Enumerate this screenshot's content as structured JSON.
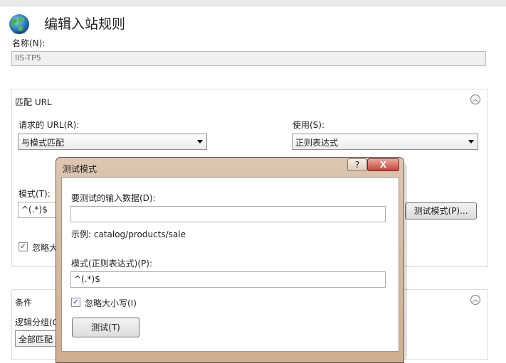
{
  "header": {
    "title": "编辑入站规则",
    "icon": "globe-icon"
  },
  "name_field": {
    "label": "名称(N):",
    "value": "IIS-TP5"
  },
  "match_url": {
    "title": "匹配 URL",
    "requested_url_label": "请求的 URL(R):",
    "requested_url_value": "与模式匹配",
    "using_label": "使用(S):",
    "using_value": "正则表达式",
    "pattern_label": "模式(T):",
    "pattern_value": "^(.*)$",
    "test_pattern_button": "测试模式(P)...",
    "ignore_case_visible": "忽略大"
  },
  "conditions": {
    "title": "条件",
    "logical_group_label": "逻辑分组(G",
    "logical_group_value": "全部匹配"
  },
  "dialog": {
    "title": "测试模式",
    "help_label": "?",
    "close_label": "X",
    "input_label": "要测试的输入数据(D):",
    "input_value": "",
    "example_text": "示例: catalog/products/sale",
    "pattern_label": "模式(正则表达式)(P):",
    "pattern_value": "^(.*)$",
    "ignore_case_label": "忽略大小写(I)",
    "ignore_case_checked": true,
    "test_button": "测试(T)"
  },
  "colors": {
    "dialog_frame": "#d4b89c",
    "close_button": "#c4443a",
    "disabled_field": "#f0f0f0"
  }
}
